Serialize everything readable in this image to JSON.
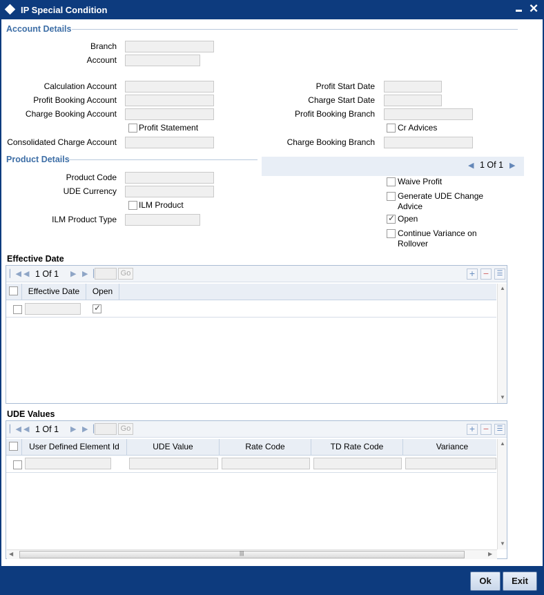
{
  "window": {
    "title": "IP Special Condition"
  },
  "account_details": {
    "section_title": "Account Details",
    "branch_label": "Branch",
    "account_label": "Account",
    "calculation_account_label": "Calculation Account",
    "profit_booking_account_label": "Profit Booking Account",
    "charge_booking_account_label": "Charge Booking Account",
    "profit_statement_label": "Profit Statement",
    "consolidated_charge_account_label": "Consolidated Charge Account",
    "profit_start_date_label": "Profit Start Date",
    "charge_start_date_label": "Charge Start Date",
    "profit_booking_branch_label": "Profit Booking Branch",
    "cr_advices_label": "Cr Advices",
    "charge_booking_branch_label": "Charge Booking Branch"
  },
  "product_details": {
    "section_title": "Product Details",
    "product_code_label": "Product Code",
    "ude_currency_label": "UDE Currency",
    "ilm_product_label": "ILM Product",
    "ilm_product_type_label": "ILM Product Type",
    "pager_text": "1 Of 1",
    "waive_profit_label": "Waive Profit",
    "generate_ude_line1": "Generate UDE Change",
    "generate_ude_line2": "Advice",
    "open_label": "Open",
    "open_checked": true,
    "continue_variance_line1": "Continue Variance on",
    "continue_variance_line2": "Rollover"
  },
  "effective_date_grid": {
    "title": "Effective Date",
    "pager_text": "1 Of 1",
    "go_label": "Go",
    "columns": [
      "Effective Date",
      "Open"
    ],
    "row_open_checked": true
  },
  "ude_values_grid": {
    "title": "UDE Values",
    "pager_text": "1 Of 1",
    "go_label": "Go",
    "columns": [
      "User Defined Element Id",
      "UDE Value",
      "Rate Code",
      "TD Rate Code",
      "Variance"
    ]
  },
  "footer": {
    "ok_label": "Ok",
    "exit_label": "Exit"
  },
  "colors": {
    "titlebar": "#0d3b7e",
    "section_title": "#3d6ea6"
  }
}
